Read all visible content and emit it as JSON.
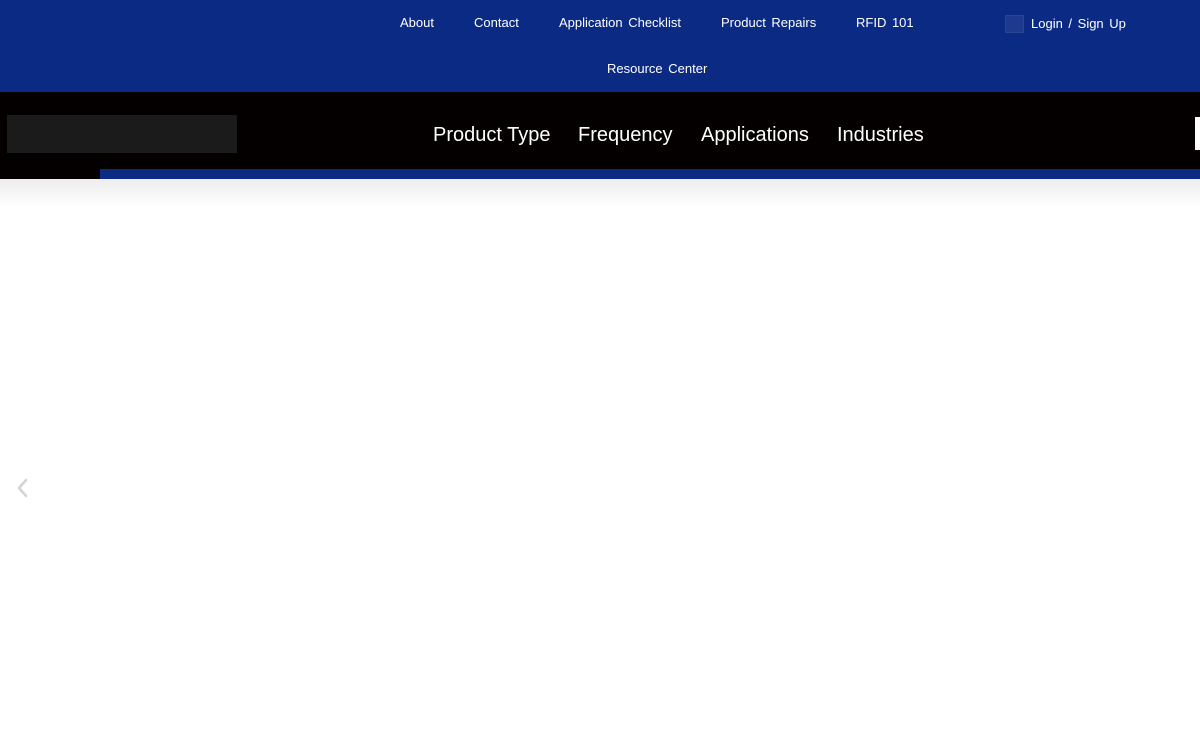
{
  "top_nav": {
    "links": [
      "About",
      "Contact",
      "Application Checklist",
      "Product Repairs",
      "RFID 101",
      "Resource Center"
    ],
    "login_label": "Login / Sign Up"
  },
  "main_nav": {
    "links": [
      "Product Type",
      "Frequency",
      "Applications",
      "Industries"
    ]
  },
  "slider": {
    "prev_icon": "chevron-left-icon"
  },
  "colors": {
    "top_bar": "#0b2a84",
    "main_bar": "#040000",
    "accent": "#0b2a84"
  }
}
